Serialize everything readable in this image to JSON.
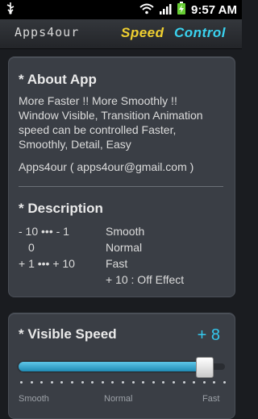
{
  "status_bar": {
    "time": "9:57 AM"
  },
  "title_bar": {
    "brand": "Apps4our",
    "title_word1": "Speed",
    "title_word2": "Control"
  },
  "about": {
    "heading": "*  About App",
    "lines": [
      "More Faster !!   More Smoothly !!",
      "Window Visible, Transition Animation",
      "speed can be controlled Faster,",
      "Smoothly, Detail, Easy"
    ],
    "contact": "Apps4our  ( apps4our@gmail.com )"
  },
  "description": {
    "heading": "*  Description",
    "rows": [
      {
        "range": "- 10    •••    - 1",
        "label": "Smooth"
      },
      {
        "range": "0",
        "label": "Normal"
      },
      {
        "range": "+ 1    •••    + 10",
        "label": "Fast"
      }
    ],
    "note": "+ 10  :  Off Effect"
  },
  "visible_speed": {
    "heading": "*  Visible Speed",
    "value": "+ 8",
    "slider": {
      "min": -10,
      "max": 10,
      "current": 8
    },
    "scale_labels": {
      "left": "Smooth",
      "center": "Normal",
      "right": "Fast"
    }
  },
  "colors": {
    "accent_yellow": "#f0d030",
    "accent_cyan": "#3ad3f0",
    "speed_value": "#34c9ef"
  },
  "icons": [
    "usb-icon",
    "wifi-icon",
    "signal-icon",
    "battery-icon"
  ]
}
